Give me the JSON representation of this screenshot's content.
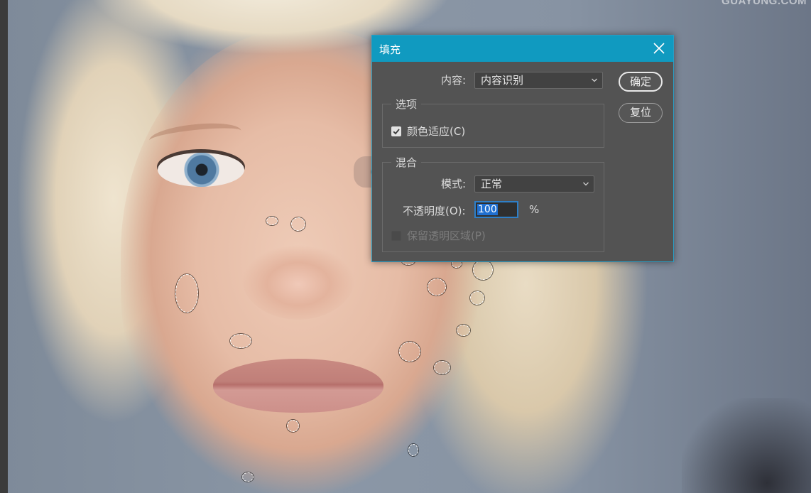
{
  "watermark": "GUAYUNG.COM",
  "dialog": {
    "title": "填充",
    "close_icon": "close-icon",
    "content_label": "内容:",
    "content_value": "内容识别",
    "ok_label": "确定",
    "reset_label": "复位",
    "options": {
      "legend": "选项",
      "color_adapt_label": "颜色适应(C)",
      "color_adapt_checked": true
    },
    "blend": {
      "legend": "混合",
      "mode_label": "模式:",
      "mode_value": "正常",
      "opacity_label": "不透明度(O):",
      "opacity_value": "100",
      "opacity_unit": "%",
      "preserve_label": "保留透明区域(P)",
      "preserve_checked": false,
      "preserve_enabled": false
    }
  },
  "colors": {
    "titlebar": "#109ac0",
    "dialog_bg": "#535353",
    "input_focus": "#2e7fc7"
  }
}
